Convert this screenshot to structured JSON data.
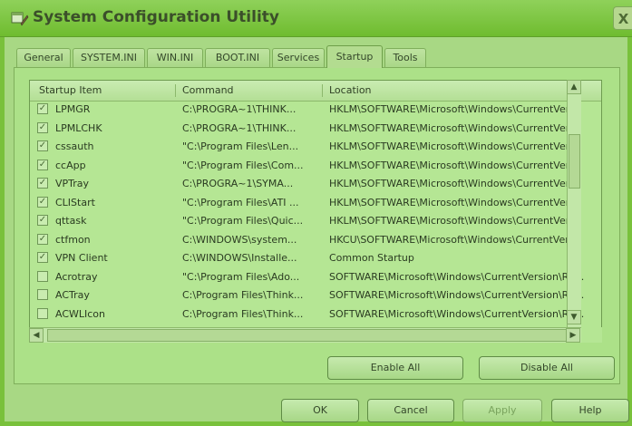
{
  "window": {
    "title": "System Configuration Utility",
    "close_glyph": "X"
  },
  "tabs": [
    "General",
    "SYSTEM.INI",
    "WIN.INI",
    "BOOT.INI",
    "Services",
    "Startup",
    "Tools"
  ],
  "active_tab": "Startup",
  "columns": [
    "Startup Item",
    "Command",
    "Location"
  ],
  "rows": [
    {
      "checked": true,
      "item": "LPMGR",
      "command": "C:\\PROGRA~1\\THINK...",
      "location": "HKLM\\SOFTWARE\\Microsoft\\Windows\\CurrentVer..."
    },
    {
      "checked": true,
      "item": "LPMLCHK",
      "command": "C:\\PROGRA~1\\THINK...",
      "location": "HKLM\\SOFTWARE\\Microsoft\\Windows\\CurrentVer..."
    },
    {
      "checked": true,
      "item": "cssauth",
      "command": "\"C:\\Program Files\\Len...",
      "location": "HKLM\\SOFTWARE\\Microsoft\\Windows\\CurrentVer..."
    },
    {
      "checked": true,
      "item": "ccApp",
      "command": "\"C:\\Program Files\\Com...",
      "location": "HKLM\\SOFTWARE\\Microsoft\\Windows\\CurrentVer..."
    },
    {
      "checked": true,
      "item": "VPTray",
      "command": "C:\\PROGRA~1\\SYMA...",
      "location": "HKLM\\SOFTWARE\\Microsoft\\Windows\\CurrentVer..."
    },
    {
      "checked": true,
      "item": "CLIStart",
      "command": "\"C:\\Program Files\\ATI ...",
      "location": "HKLM\\SOFTWARE\\Microsoft\\Windows\\CurrentVer..."
    },
    {
      "checked": true,
      "item": "qttask",
      "command": "\"C:\\Program Files\\Quic...",
      "location": "HKLM\\SOFTWARE\\Microsoft\\Windows\\CurrentVer..."
    },
    {
      "checked": true,
      "item": "ctfmon",
      "command": "C:\\WINDOWS\\system...",
      "location": "HKCU\\SOFTWARE\\Microsoft\\Windows\\CurrentVer..."
    },
    {
      "checked": true,
      "item": "VPN Client",
      "command": "C:\\WINDOWS\\Installe...",
      "location": "Common Startup"
    },
    {
      "checked": false,
      "item": "Acrotray",
      "command": "\"C:\\Program Files\\Ado...",
      "location": "SOFTWARE\\Microsoft\\Windows\\CurrentVersion\\Ru..."
    },
    {
      "checked": false,
      "item": "ACTray",
      "command": "C:\\Program Files\\Think...",
      "location": "SOFTWARE\\Microsoft\\Windows\\CurrentVersion\\Ru..."
    },
    {
      "checked": false,
      "item": "ACWLIcon",
      "command": "C:\\Program Files\\Think...",
      "location": "SOFTWARE\\Microsoft\\Windows\\CurrentVersion\\Ru..."
    }
  ],
  "buttons": {
    "enable_all": "Enable All",
    "disable_all": "Disable All",
    "ok": "OK",
    "cancel": "Cancel",
    "apply": "Apply",
    "help": "Help"
  },
  "icons": {
    "check": "✓",
    "scroll_up": "▲",
    "scroll_down": "▼",
    "scroll_left": "◀",
    "scroll_right": "▶"
  }
}
